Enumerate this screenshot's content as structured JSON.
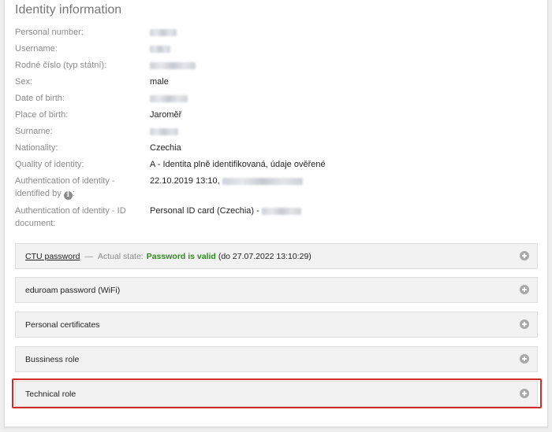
{
  "page": {
    "title": "Identity information"
  },
  "identity": {
    "rows": [
      {
        "label": "Personal number:",
        "value": "",
        "redacted": true
      },
      {
        "label": "Username:",
        "value": "",
        "redacted": true
      },
      {
        "label": "Rodné číslo (typ státní):",
        "value": "",
        "redacted": true
      },
      {
        "label": "Sex:",
        "value": "male",
        "redacted": false
      },
      {
        "label": "Date of birth:",
        "value": "",
        "redacted": true
      },
      {
        "label": "Place of birth:",
        "value": "Jaroměř",
        "redacted": false
      },
      {
        "label": "Surname:",
        "value": "",
        "redacted": true
      },
      {
        "label": "Nationality:",
        "value": "Czechia",
        "redacted": false
      },
      {
        "label": "Quality of identity:",
        "value": "A - Identita plně identifikovaná, údaje ověřené",
        "redacted": false
      }
    ],
    "auth_identified": {
      "label_line1": "Authentication of identity -",
      "label_line2": "identified by",
      "info_icon": "info-circle-icon",
      "value": "22.10.2019 13:10,"
    },
    "auth_document": {
      "label_line1": "Authentication of identity - ID",
      "label_line2": "document:",
      "value": "Personal ID card (Czechia) -"
    }
  },
  "sections": {
    "ctu_password": {
      "link": "CTU password",
      "dash": "—",
      "state_label": "Actual state:",
      "state_value": "Password is valid",
      "valid_until": "(do 27.07.2022 13:10:29)"
    },
    "eduroam": {
      "label": "eduroam password (WiFi)"
    },
    "certificates": {
      "label": "Personal certificates"
    },
    "business_role": {
      "label": "Bussiness role"
    },
    "technical_role": {
      "label": "Technical role"
    }
  },
  "icons": {
    "expand": "plus-circle-icon"
  },
  "colors": {
    "valid_green": "#2e8b1e",
    "highlight_red": "#d32a2a"
  }
}
